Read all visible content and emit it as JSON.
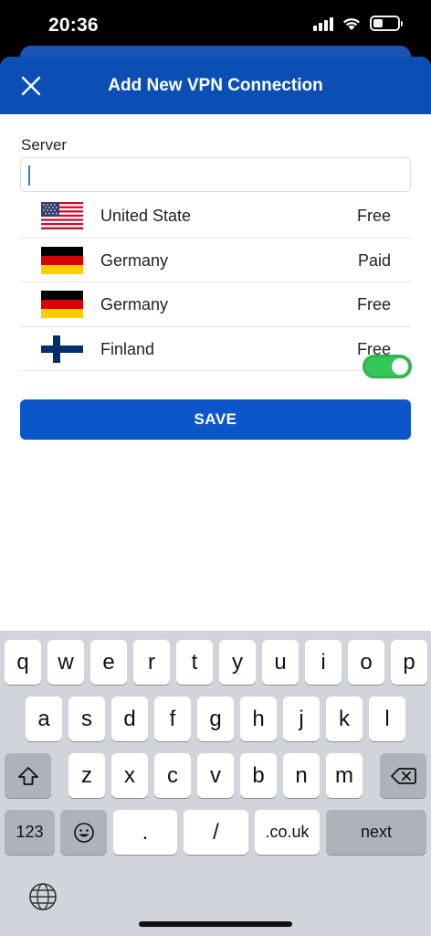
{
  "status": {
    "time": "20:36"
  },
  "header": {
    "title": "Add New VPN Connection"
  },
  "form": {
    "server_label": "Server",
    "server_value": "",
    "save_label": "SAVE"
  },
  "servers": [
    {
      "name": "United State",
      "tier": "Free",
      "flag": "us-flag-icon"
    },
    {
      "name": "Germany",
      "tier": "Paid",
      "flag": "de-flag-icon"
    },
    {
      "name": "Germany",
      "tier": "Free",
      "flag": "de-flag-icon"
    },
    {
      "name": "Finland",
      "tier": "Free",
      "flag": "fi-flag-icon"
    }
  ],
  "keyboard": {
    "row1": [
      "q",
      "w",
      "e",
      "r",
      "t",
      "y",
      "u",
      "i",
      "o",
      "p"
    ],
    "row2": [
      "a",
      "s",
      "d",
      "f",
      "g",
      "h",
      "j",
      "k",
      "l"
    ],
    "row3": [
      "z",
      "x",
      "c",
      "v",
      "b",
      "n",
      "m"
    ],
    "numbers_key": "123",
    "dot_key": ".",
    "slash_key": "/",
    "domain_key": ".co.uk",
    "next_key": "next"
  },
  "colors": {
    "header_blue": "#0b4fb4",
    "save_blue": "#0b57c9",
    "toggle_green": "#34c759"
  }
}
